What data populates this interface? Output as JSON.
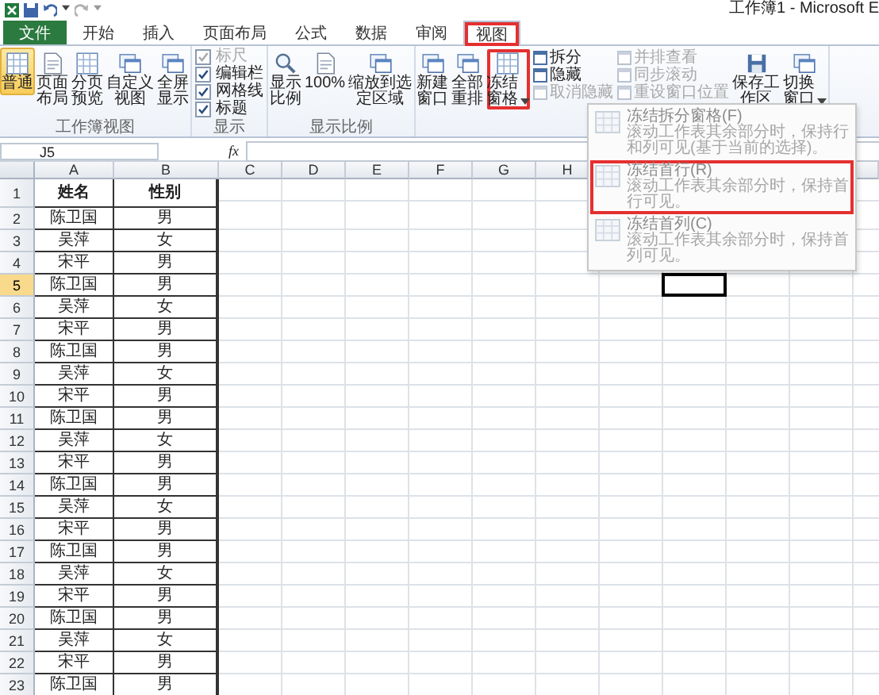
{
  "title_bar": {
    "title": "工作簿1 - Microsoft E"
  },
  "tabs": [
    {
      "label": "文件",
      "kind": "file",
      "selected": false,
      "highlighted": false
    },
    {
      "label": "开始",
      "kind": "tab",
      "selected": false,
      "highlighted": false
    },
    {
      "label": "插入",
      "kind": "tab",
      "selected": false,
      "highlighted": false
    },
    {
      "label": "页面布局",
      "kind": "tab",
      "selected": false,
      "highlighted": false
    },
    {
      "label": "公式",
      "kind": "tab",
      "selected": false,
      "highlighted": false
    },
    {
      "label": "数据",
      "kind": "tab",
      "selected": false,
      "highlighted": false
    },
    {
      "label": "审阅",
      "kind": "tab",
      "selected": false,
      "highlighted": false
    },
    {
      "label": "视图",
      "kind": "tab",
      "selected": true,
      "highlighted": true
    }
  ],
  "ribbon": {
    "groups": [
      {
        "label": "工作簿视图",
        "items": [
          {
            "kind": "big",
            "label": "普通",
            "selected": true
          },
          {
            "kind": "big",
            "label": "页面布局",
            "selected": false
          },
          {
            "kind": "big",
            "label": "分页预览",
            "selected": false
          },
          {
            "kind": "big",
            "label": "自定义视图",
            "selected": false
          },
          {
            "kind": "big",
            "label": "全屏显示",
            "selected": false
          }
        ]
      },
      {
        "label": "显示",
        "items": [
          {
            "kind": "checkbox",
            "label": "标尺",
            "checked": true,
            "disabled": true
          },
          {
            "kind": "checkbox",
            "label": "编辑栏",
            "checked": true,
            "disabled": false
          },
          {
            "kind": "checkbox",
            "label": "网格线",
            "checked": true,
            "disabled": false
          },
          {
            "kind": "checkbox",
            "label": "标题",
            "checked": true,
            "disabled": false
          }
        ]
      },
      {
        "label": "显示比例",
        "items": [
          {
            "kind": "big",
            "label": "显示比例",
            "selected": false
          },
          {
            "kind": "big",
            "label": "100%",
            "selected": false
          },
          {
            "kind": "big",
            "label": "缩放到选定区域",
            "selected": false
          }
        ]
      },
      {
        "items": [
          {
            "kind": "big",
            "label": "新建窗口",
            "selected": false
          },
          {
            "kind": "big",
            "label": "全部重排",
            "selected": false
          },
          {
            "kind": "big",
            "label": "冻结窗格",
            "selected": false,
            "dropdown": true,
            "highlighted": true
          },
          {
            "kind": "small_column",
            "buttons": [
              {
                "label": "拆分",
                "disabled": false
              },
              {
                "label": "隐藏",
                "disabled": false
              },
              {
                "label": "取消隐藏",
                "disabled": true
              }
            ]
          },
          {
            "kind": "small_column",
            "buttons": [
              {
                "label": "并排查看",
                "disabled": true
              },
              {
                "label": "同步滚动",
                "disabled": true
              },
              {
                "label": "重设窗口位置",
                "disabled": true
              }
            ]
          },
          {
            "kind": "big",
            "label": "保存工作区",
            "selected": false
          },
          {
            "kind": "big",
            "label": "切换窗口",
            "selected": false,
            "dropdown": true
          }
        ]
      }
    ]
  },
  "formula_bar": {
    "name_box": "J5",
    "fx": "fx"
  },
  "columns": [
    "A",
    "B",
    "C",
    "D",
    "E",
    "F",
    "G",
    "H"
  ],
  "rows": [
    {
      "num": "1",
      "kind": "header",
      "cells": [
        "姓名",
        "性别"
      ],
      "selected": false
    },
    {
      "num": "2",
      "kind": "data",
      "cells": [
        "陈卫国",
        "男"
      ],
      "selected": false
    },
    {
      "num": "3",
      "kind": "data",
      "cells": [
        "吴萍",
        "女"
      ],
      "selected": false
    },
    {
      "num": "4",
      "kind": "data",
      "cells": [
        "宋平",
        "男"
      ],
      "selected": false
    },
    {
      "num": "5",
      "kind": "data",
      "cells": [
        "陈卫国",
        "男"
      ],
      "selected": true
    },
    {
      "num": "6",
      "kind": "data",
      "cells": [
        "吴萍",
        "女"
      ],
      "selected": false
    },
    {
      "num": "7",
      "kind": "data",
      "cells": [
        "宋平",
        "男"
      ],
      "selected": false
    },
    {
      "num": "8",
      "kind": "data",
      "cells": [
        "陈卫国",
        "男"
      ],
      "selected": false
    },
    {
      "num": "9",
      "kind": "data",
      "cells": [
        "吴萍",
        "女"
      ],
      "selected": false
    },
    {
      "num": "10",
      "kind": "data",
      "cells": [
        "宋平",
        "男"
      ],
      "selected": false
    },
    {
      "num": "11",
      "kind": "data",
      "cells": [
        "陈卫国",
        "男"
      ],
      "selected": false
    },
    {
      "num": "12",
      "kind": "data",
      "cells": [
        "吴萍",
        "女"
      ],
      "selected": false
    },
    {
      "num": "13",
      "kind": "data",
      "cells": [
        "宋平",
        "男"
      ],
      "selected": false
    },
    {
      "num": "14",
      "kind": "data",
      "cells": [
        "陈卫国",
        "男"
      ],
      "selected": false
    },
    {
      "num": "15",
      "kind": "data",
      "cells": [
        "吴萍",
        "女"
      ],
      "selected": false
    },
    {
      "num": "16",
      "kind": "data",
      "cells": [
        "宋平",
        "男"
      ],
      "selected": false
    },
    {
      "num": "17",
      "kind": "data",
      "cells": [
        "陈卫国",
        "男"
      ],
      "selected": false
    },
    {
      "num": "18",
      "kind": "data",
      "cells": [
        "吴萍",
        "女"
      ],
      "selected": false
    },
    {
      "num": "19",
      "kind": "data",
      "cells": [
        "宋平",
        "男"
      ],
      "selected": false
    },
    {
      "num": "20",
      "kind": "data",
      "cells": [
        "陈卫国",
        "男"
      ],
      "selected": false
    },
    {
      "num": "21",
      "kind": "data",
      "cells": [
        "吴萍",
        "女"
      ],
      "selected": false
    },
    {
      "num": "22",
      "kind": "data",
      "cells": [
        "宋平",
        "男"
      ],
      "selected": false
    },
    {
      "num": "23",
      "kind": "data",
      "cells": [
        "陈卫国",
        "男"
      ],
      "selected": false
    }
  ],
  "freeze_menu": {
    "items": [
      {
        "title": "冻结拆分窗格(F)",
        "description": "滚动工作表其余部分时，保持行和列可见(基于当前的选择)。",
        "highlighted": false
      },
      {
        "title": "冻结首行(R)",
        "description": "滚动工作表其余部分时，保持首行可见。",
        "highlighted": true
      },
      {
        "title": "冻结首列(C)",
        "description": "滚动工作表其余部分时，保持首列可见。",
        "highlighted": false
      }
    ]
  }
}
